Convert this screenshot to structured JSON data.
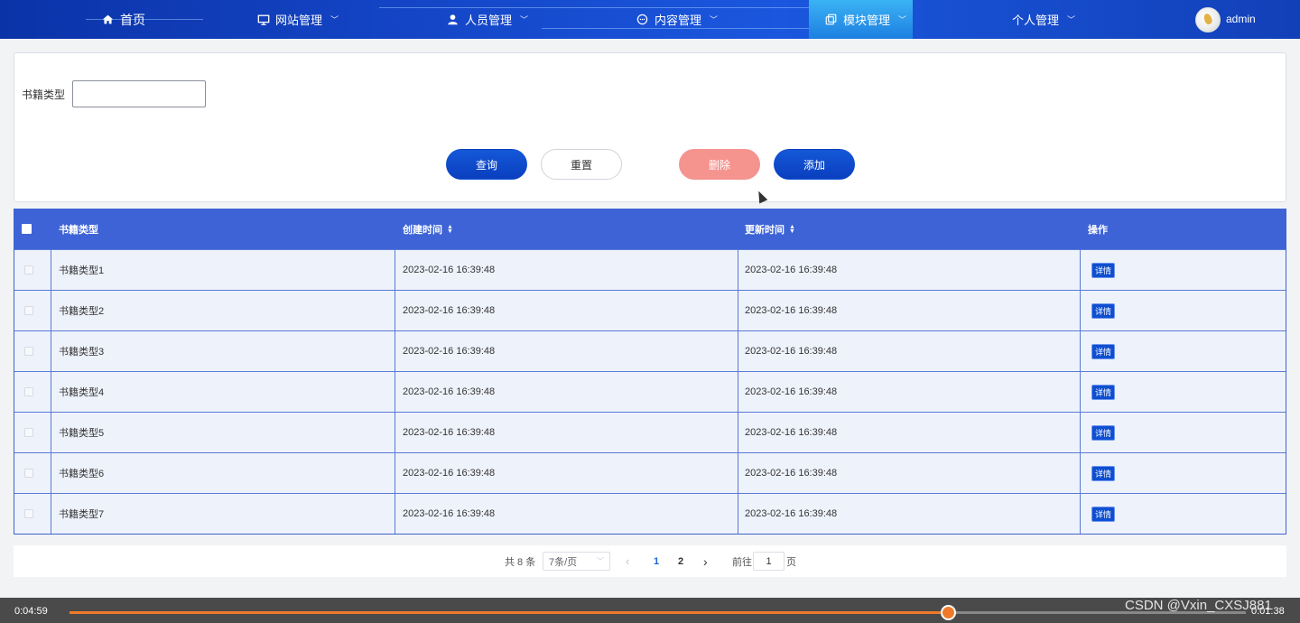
{
  "nav": {
    "items": [
      {
        "label": "首页",
        "icon": "home-icon"
      },
      {
        "label": "网站管理",
        "icon": "monitor-icon"
      },
      {
        "label": "人员管理",
        "icon": "user-icon"
      },
      {
        "label": "内容管理",
        "icon": "chat-icon"
      },
      {
        "label": "模块管理",
        "icon": "module-icon",
        "active": true
      },
      {
        "label": "个人管理"
      }
    ],
    "username": "admin"
  },
  "search": {
    "label": "书籍类型",
    "value": "",
    "buttons": {
      "query": "查询",
      "reset": "重置",
      "delete": "删除",
      "add": "添加"
    }
  },
  "table": {
    "columns": [
      "书籍类型",
      "创建时间",
      "更新时间",
      "操作"
    ],
    "rows": [
      {
        "type": "书籍类型1",
        "created": "2023-02-16 16:39:48",
        "updated": "2023-02-16 16:39:48",
        "action": "详情"
      },
      {
        "type": "书籍类型2",
        "created": "2023-02-16 16:39:48",
        "updated": "2023-02-16 16:39:48",
        "action": "详情"
      },
      {
        "type": "书籍类型3",
        "created": "2023-02-16 16:39:48",
        "updated": "2023-02-16 16:39:48",
        "action": "详情"
      },
      {
        "type": "书籍类型4",
        "created": "2023-02-16 16:39:48",
        "updated": "2023-02-16 16:39:48",
        "action": "详情"
      },
      {
        "type": "书籍类型5",
        "created": "2023-02-16 16:39:48",
        "updated": "2023-02-16 16:39:48",
        "action": "详情"
      },
      {
        "type": "书籍类型6",
        "created": "2023-02-16 16:39:48",
        "updated": "2023-02-16 16:39:48",
        "action": "详情"
      },
      {
        "type": "书籍类型7",
        "created": "2023-02-16 16:39:48",
        "updated": "2023-02-16 16:39:48",
        "action": "详情"
      }
    ]
  },
  "pagination": {
    "total": "共 8 条",
    "page_size": "7条/页",
    "pages": [
      "1",
      "2"
    ],
    "current_page": "1",
    "goto_prefix": "前往",
    "goto_value": "1",
    "goto_suffix": "页"
  },
  "video": {
    "current_time": "0:04:59",
    "total_time": "0:01:38",
    "progress": 0.747,
    "watermark": "CSDN @Vxin_CXSJ881"
  },
  "colors": {
    "nav_bg": "#1547c9",
    "primary": "#0f4fd0",
    "table_header": "#3d63d6",
    "delete": "#f5938f",
    "progress": "#f07a2a"
  }
}
